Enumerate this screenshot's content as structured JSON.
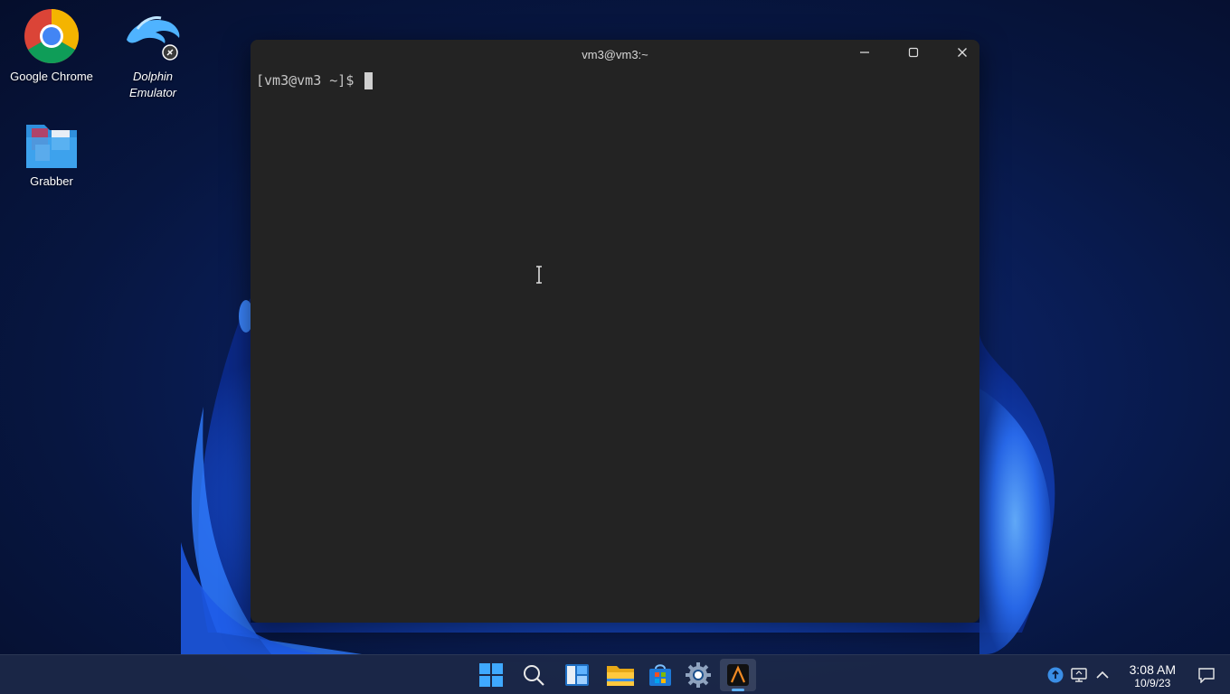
{
  "desktop": {
    "icons": [
      {
        "label": "Google Chrome",
        "icon": "chrome-icon"
      },
      {
        "label": "Dolphin Emulator",
        "icon": "dolphin-icon"
      },
      {
        "label": "Grabber",
        "icon": "folder-icon"
      }
    ]
  },
  "terminal": {
    "title": "vm3@vm3:~",
    "prompt": "[vm3@vm3 ~]$ "
  },
  "taskbar": {
    "apps": [
      {
        "name": "start",
        "icon": "windows-start-icon"
      },
      {
        "name": "search",
        "icon": "search-icon"
      },
      {
        "name": "widgets",
        "icon": "widgets-icon"
      },
      {
        "name": "file-explorer",
        "icon": "folder-icon"
      },
      {
        "name": "store",
        "icon": "store-icon"
      },
      {
        "name": "settings",
        "icon": "gear-icon"
      },
      {
        "name": "terminal",
        "icon": "terminal-icon",
        "active": true
      }
    ],
    "tray": {
      "time": "3:08 AM",
      "date": "10/9/23"
    }
  },
  "colors": {
    "terminal_bg": "#232323",
    "taskbar_bg": "#1c2848",
    "accent": "#5fb2ff"
  }
}
